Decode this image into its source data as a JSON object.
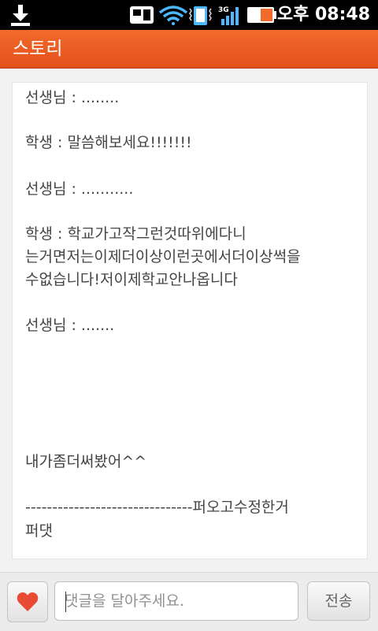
{
  "status_bar": {
    "time": "오후 08:48",
    "network_label": "3G",
    "icons": [
      "download-icon",
      "media-icon",
      "wifi-icon",
      "vibrate-icon",
      "signal-icon",
      "battery-icon"
    ]
  },
  "app": {
    "title": "스토리",
    "accent_color": "#e85a21"
  },
  "story": {
    "lines": [
      "선생님 : ........",
      "학생 : 말씀해보세요!!!!!!!",
      "선생님 : ...........",
      "학생 : 학교가고작그런것따위에다니",
      "는거면저는이제더이상이런곳에서더이상썩을",
      "수없습니다!저이제학교안나옵니다",
      "선생님 : .......",
      "내가좀더써봤어^^",
      "-------------------------------퍼오고수정한거",
      "퍼댓"
    ]
  },
  "comment_bar": {
    "like_icon": "heart-icon",
    "input_placeholder": "댓글을 달아주세요.",
    "send_label": "전송"
  }
}
